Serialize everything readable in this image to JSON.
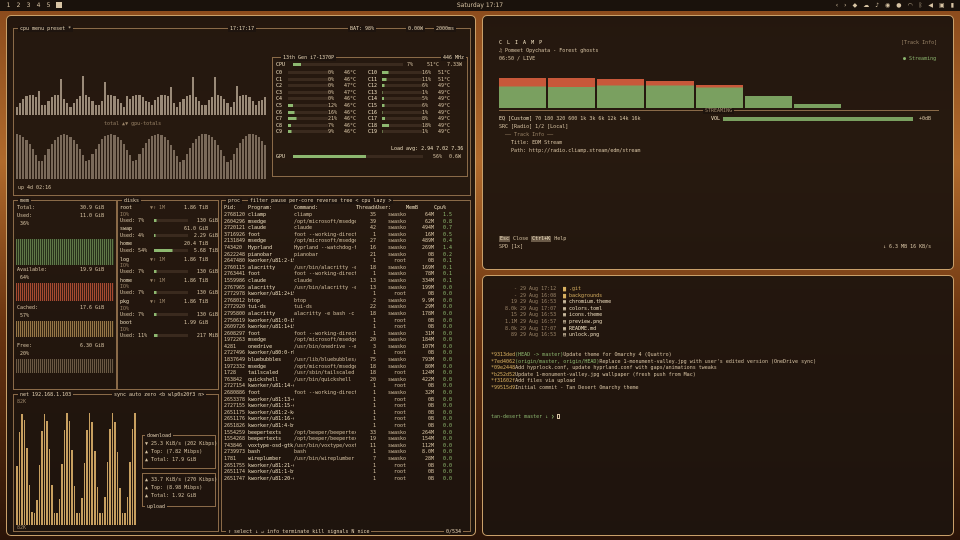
{
  "topbar": {
    "workspaces": [
      "1",
      "2",
      "3",
      "4",
      "5"
    ],
    "clock": "Saturday 17:17",
    "tray_icons": [
      "chevron-left-icon",
      "chevron-right-icon",
      "dropbox-icon",
      "cloud-icon",
      "bell-icon",
      "headphones-icon",
      "mic-icon",
      "wifi-icon",
      "bluetooth-icon",
      "volume-icon",
      "cpu-icon",
      "battery-icon"
    ]
  },
  "btop": {
    "cpu_header": {
      "menu": "cpu menu preset *",
      "time": "17:17:17",
      "bat": "BAT: 98%",
      "interval": "2000ms",
      "power": "0.00W"
    },
    "cpu_box_title": "13th Gen i7-1370P",
    "cpu_freq": "446 MHz",
    "cpu_total": {
      "label": "CPU",
      "pct": "7%",
      "temp": "51°C",
      "value": "7.33W"
    },
    "cores": [
      {
        "c": "C0",
        "p": "0%",
        "t": "46°C",
        "c2": "C10",
        "p2": "16%",
        "t2": "51°C"
      },
      {
        "c": "C1",
        "p": "0%",
        "t": "46°C",
        "c2": "C11",
        "p2": "11%",
        "t2": "51°C"
      },
      {
        "c": "C2",
        "p": "0%",
        "t": "47°C",
        "c2": "C12",
        "p2": "6%",
        "t2": "49°C"
      },
      {
        "c": "C3",
        "p": "0%",
        "t": "47°C",
        "c2": "C13",
        "p2": "1%",
        "t2": "49°C"
      },
      {
        "c": "C4",
        "p": "0%",
        "t": "46°C",
        "c2": "C14",
        "p2": "5%",
        "t2": "49°C"
      },
      {
        "c": "C5",
        "p": "12%",
        "t": "46°C",
        "c2": "C15",
        "p2": "6%",
        "t2": "49°C"
      },
      {
        "c": "C6",
        "p": "16%",
        "t": "46°C",
        "c2": "C16",
        "p2": "1%",
        "t2": "49°C"
      },
      {
        "c": "C7",
        "p": "21%",
        "t": "46°C",
        "c2": "C17",
        "p2": "8%",
        "t2": "49°C"
      },
      {
        "c": "C8",
        "p": "7%",
        "t": "46°C",
        "c2": "C18",
        "p2": "18%",
        "t2": "49°C"
      },
      {
        "c": "C9",
        "p": "9%",
        "t": "46°C",
        "c2": "C19",
        "p2": "1%",
        "t2": "49°C"
      }
    ],
    "load_avg": "Load avg: 2.94 7.02 7.36",
    "gpu": {
      "label": "GPU",
      "pct": "56%",
      "value": "0.6W"
    },
    "graph_label": "total ▲▼ gpu-totals",
    "uptime": "up 4d 02:16",
    "mem": {
      "title": "mem",
      "total": "30.9 GiB",
      "used_label": "Used:",
      "used": "11.0 GiB",
      "used_pct": "36%",
      "available_label": "Available:",
      "available": "19.9 GiB",
      "available_pct": "64%",
      "cached_label": "Cached:",
      "cached": "17.6 GiB",
      "cached_pct": "57%",
      "free_label": "Free:",
      "free": "6.30 GiB",
      "free_pct": "20%"
    },
    "disks": {
      "title": "disks",
      "items": [
        {
          "name": "root",
          "speed": "▼↑ 1M",
          "size": "1.86 TiB",
          "io": "IO%",
          "used": "7%",
          "val": "130 GiB"
        },
        {
          "name": "swap",
          "speed": "",
          "size": "61.0 GiB",
          "io": "",
          "used": "4%",
          "val": "2.29 GiB"
        },
        {
          "name": "home",
          "speed": "",
          "size": "20.4 TiB",
          "io": "",
          "used": "54%",
          "val": "5.68 TiB"
        },
        {
          "name": "log",
          "speed": "▼↑ 1M",
          "size": "1.86 TiB",
          "io": "IO%",
          "used": "7%",
          "val": "130 GiB"
        },
        {
          "name": "home",
          "speed": "▼↑ 1M",
          "size": "1.86 TiB",
          "io": "IO%",
          "used": "7%",
          "val": "130 GiB"
        },
        {
          "name": "pkg",
          "speed": "▼↑ 1M",
          "size": "1.86 TiB",
          "io": "IO%",
          "used": "7%",
          "val": "130 GiB"
        },
        {
          "name": "boot",
          "speed": "",
          "size": "1.99 GiB",
          "io": "IO%",
          "used": "11%",
          "val": "217 MiB"
        }
      ]
    },
    "net": {
      "title": "net",
      "ip": "192.168.1.103",
      "controls": "sync auto zero <b wlp0s20f3 n>",
      "scale_top": "82K",
      "scale_bottom": "82K",
      "download_label": "download",
      "download": "25.3 KiB/s",
      "download_bits": "(202 Kibps)",
      "download_top": "(7.82 Mibps)",
      "download_total": "17.9 GiB",
      "upload_label": "upload",
      "upload": "33.7 KiB/s",
      "upload_bits": "(270 Kibps)",
      "upload_top": "(8.98 Mibps)",
      "upload_total": "1.92 GiB",
      "top_label": "Top:",
      "total_label": "Total:"
    },
    "proc": {
      "title": "proc",
      "header_tags": "filter pause per-core reverse tree < cpu lazy >",
      "columns": [
        "Pid:",
        "Program:",
        "Command:",
        "Threads:",
        "User:",
        "MemB",
        "Cpu%"
      ],
      "rows": [
        [
          "2768120",
          "cliamp",
          "cliamp",
          "35",
          "swasko",
          "64M",
          "1.5"
        ],
        [
          "2604296",
          "msedge",
          "/opt/microsoft/msedge",
          "39",
          "swasko",
          "62M",
          "0.8"
        ],
        [
          "2720121",
          "claude",
          "claude",
          "42",
          "swasko",
          "494M",
          "0.7"
        ],
        [
          "3716926",
          "foot",
          "foot --working-direct",
          "1",
          "swasko",
          "16M",
          "0.5"
        ],
        [
          "2131849",
          "msedge",
          "/opt/microsoft/msedge",
          "27",
          "swasko",
          "489M",
          "0.4"
        ],
        [
          "743420",
          "Hyprland",
          "Hyprland --watchdog-f",
          "16",
          "swasko",
          "269M",
          "1.4"
        ],
        [
          "2622248",
          "pianobar",
          "pianobar",
          "21",
          "swasko",
          "0B",
          "0.2"
        ],
        [
          "2647480",
          "kworker/u81:2-i9",
          "",
          "1",
          "root",
          "0B",
          "0.1"
        ],
        [
          "2760115",
          "alacritty",
          "/usr/bin/alacritty -e",
          "18",
          "swasko",
          "169M",
          "0.1"
        ],
        [
          "2763441",
          "foot",
          "foot --working-direct",
          "1",
          "swasko",
          "78M",
          "0.1"
        ],
        [
          "1559986",
          "claude",
          "claude",
          "13",
          "swasko",
          "334M",
          "0.1"
        ],
        [
          "2767965",
          "alacritty",
          "/usr/bin/alacritty -e",
          "13",
          "swasko",
          "199M",
          "0.0"
        ],
        [
          "2772978",
          "kworker/u81:2+i9",
          "",
          "1",
          "root",
          "0B",
          "0.0"
        ],
        [
          "2768012",
          "btop",
          "btop",
          "2",
          "swasko",
          "9.9M",
          "0.0"
        ],
        [
          "2772920",
          "tui-ds",
          "tui-ds",
          "22",
          "swasko",
          "29M",
          "0.0"
        ],
        [
          "2795800",
          "alacritty",
          "alacritty -e bash -c",
          "18",
          "swasko",
          "178M",
          "0.0"
        ],
        [
          "2750619",
          "kworker/u81:0-i9",
          "",
          "1",
          "root",
          "0B",
          "0.0"
        ],
        [
          "2609726",
          "kworker/u81:1+i9",
          "",
          "1",
          "root",
          "0B",
          "0.0"
        ],
        [
          "2608297",
          "foot",
          "foot --working-direct",
          "1",
          "swasko",
          "31M",
          "0.0"
        ],
        [
          "1972263",
          "msedge",
          "/opt/microsoft/msedge",
          "20",
          "swasko",
          "184M",
          "0.0"
        ],
        [
          "4281",
          "onedrive",
          "/usr/bin/onedrive --m",
          "3",
          "swasko",
          "107M",
          "0.0"
        ],
        [
          "2727496",
          "kworker/u80:0-rk",
          "",
          "1",
          "root",
          "0B",
          "0.0"
        ],
        [
          "1837649",
          "bluebubbles",
          "/usr/lib/bluebubbles/",
          "75",
          "swasko",
          "793M",
          "0.0"
        ],
        [
          "1972332",
          "msedge",
          "/opt/microsoft/msedge",
          "18",
          "swasko",
          "80M",
          "0.0"
        ],
        [
          "1728",
          "tailscaled",
          "/usr/sbin/tailscaled",
          "18",
          "root",
          "124M",
          "0.0"
        ],
        [
          "763842",
          "quickshell",
          "/usr/bin/quickshell",
          "20",
          "swasko",
          "422M",
          "0.0"
        ],
        [
          "2727154",
          "kworker/u81:14-e",
          "",
          "1",
          "root",
          "0B",
          "0.0"
        ],
        [
          "2680886",
          "foot",
          "foot --working-direct",
          "1",
          "swasko",
          "32M",
          "0.0"
        ],
        [
          "2653378",
          "kworker/u81:13-e",
          "",
          "1",
          "root",
          "0B",
          "0.0"
        ],
        [
          "2727155",
          "kworker/u81:15-e",
          "",
          "1",
          "root",
          "0B",
          "0.0"
        ],
        [
          "2651175",
          "kworker/u81:2-kc",
          "",
          "1",
          "root",
          "0B",
          "0.0"
        ],
        [
          "2651176",
          "kworker/u81:16-e",
          "",
          "1",
          "root",
          "0B",
          "0.0"
        ],
        [
          "2651826",
          "kworker/u81:4-bt",
          "",
          "1",
          "root",
          "0B",
          "0.0"
        ],
        [
          "1554259",
          "beepertexts",
          "/opt/beeper/beepertex",
          "33",
          "swasko",
          "264M",
          "0.0"
        ],
        [
          "1554268",
          "beepertexts",
          "/opt/beeper/beepertex",
          "19",
          "swasko",
          "154M",
          "0.0"
        ],
        [
          "743846",
          "voxtype-osd-gtk",
          "/usr/bin/voxtype/voxt",
          "11",
          "swasko",
          "112M",
          "0.0"
        ],
        [
          "2739973",
          "bash",
          "bash",
          "1",
          "swasko",
          "8.0M",
          "0.0"
        ],
        [
          "1781",
          "wireplumber",
          "/usr/bin/wireplumber",
          "7",
          "swasko",
          "28M",
          "0.0"
        ],
        [
          "2651755",
          "kworker/u81:21-e",
          "",
          "1",
          "root",
          "0B",
          "0.0"
        ],
        [
          "2651174",
          "kworker/u81:1-bt",
          "",
          "1",
          "root",
          "0B",
          "0.0"
        ],
        [
          "2651747",
          "kworker/u81:20-e",
          "",
          "1",
          "root",
          "0B",
          "0.0"
        ]
      ],
      "footer": "↑ select ↓ ↵ info  terminate  kill  signals  N nice",
      "count": "0/534"
    }
  },
  "music": {
    "logo": "C L I A M P",
    "track_line": "♫ Pomeet Opychata - Forest ghosts",
    "time": "06:50 / LIVE",
    "track_info_label": "[Track Info]",
    "status": "● Streaming",
    "streaming_label": "STREAMING",
    "eq_label": "EQ [Custom]",
    "eq_bands": "70 180 320 600 1k 3k 6k 12k 14k 16k",
    "src_label": "SRC [Radio] 1/2 [Local]",
    "vol_label": "VOL",
    "vol_value": "+0dB",
    "track_info_title": "── Track Info ──",
    "title_label": "Title: EDM Stream",
    "path_label": "Path: http://radio.cliamp.stream/edm/stream",
    "keys": [
      {
        "key": "Esc",
        "desc": "Close"
      },
      {
        "key": "Ctrl+K",
        "desc": "Help"
      }
    ],
    "spd": "SPD [1x]",
    "net_rate": "↓ 6.3 MB   16 KB/s",
    "chart_bars": [
      {
        "r": 0.84,
        "g": 0.6
      },
      {
        "r": 0.83,
        "g": 0.58
      },
      {
        "r": 0.8,
        "g": 0.62
      },
      {
        "r": 0.74,
        "g": 0.62
      },
      {
        "r": 0.64,
        "g": 0.57
      },
      {
        "r": 0.32,
        "g": 0.32
      },
      {
        "r": 0.12,
        "g": 0.12
      }
    ],
    "colors": {
      "eq_red": "#c8583a",
      "eq_green": "#7aa060"
    }
  },
  "terminal": {
    "files": [
      {
        "perm": "-",
        "date": "29 Aug 17:12",
        "name": ".git",
        "icon": "folder"
      },
      {
        "perm": "-",
        "date": "29 Aug 16:08",
        "name": "backgrounds",
        "icon": "folder"
      },
      {
        "perm": "19",
        "date": "29 Aug 16:53",
        "name": "chromium.theme",
        "icon": "file"
      },
      {
        "perm": "8.0k",
        "date": "29 Aug 17:07",
        "name": "colors.toml",
        "icon": "file"
      },
      {
        "perm": "15",
        "date": "29 Aug 16:53",
        "name": "icons.theme",
        "icon": "file"
      },
      {
        "perm": "1.1M",
        "date": "29 Aug 16:57",
        "name": "preview.png",
        "icon": "image"
      },
      {
        "perm": "8.0k",
        "date": "29 Aug 17:07",
        "name": "README.md",
        "icon": "file"
      },
      {
        "perm": "89",
        "date": "29 Aug 16:53",
        "name": "unlock.png",
        "icon": "image"
      }
    ],
    "commits": [
      {
        "hash": "9313ded",
        "ref": "(HEAD -> master)",
        "msg": "Update theme for Omarchy 4 (Quattro)"
      },
      {
        "hash": "7ed4062",
        "ref": "(origin/master, origin/HEAD)",
        "msg": "Replace 1-monument-valley.jpg with user's edited version (OneDrive sync)"
      },
      {
        "hash": "09e2448",
        "ref": "",
        "msg": "Add hyprlock.conf, update hyprland.conf with gaps/animations tweaks"
      },
      {
        "hash": "b252d52",
        "ref": "",
        "msg": "Update 1-monument-valley.jpg wallpaper (fresh push from Mac)"
      },
      {
        "hash": "f31602f",
        "ref": "",
        "msg": "Add files via upload"
      },
      {
        "hash": "99515d9",
        "ref": "",
        "msg": "Initial commit - Tan Desert Omarchy theme"
      }
    ],
    "prompt": "tan-desert master ↓ ❯"
  }
}
